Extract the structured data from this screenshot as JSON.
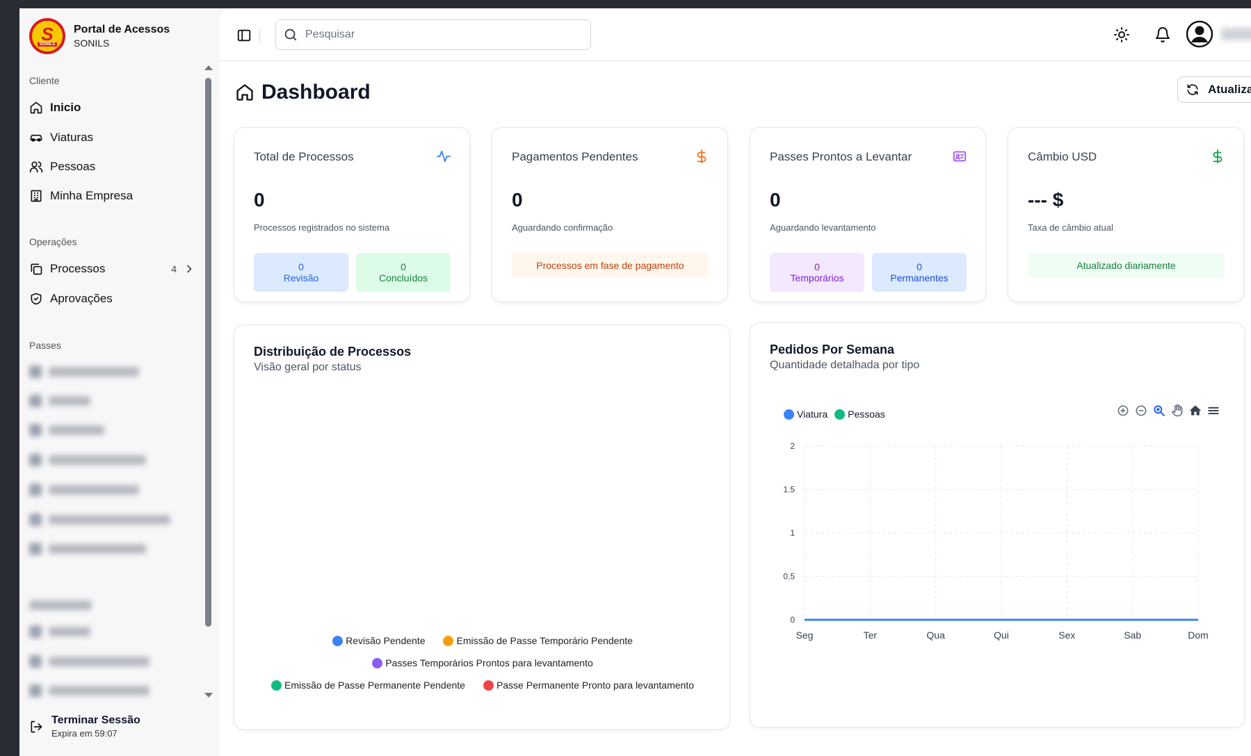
{
  "sidebar": {
    "brand_title": "Portal de Acessos",
    "brand_sub": "SONILS",
    "logo_text": "S",
    "logo_band": "SONILS",
    "section_cliente": "Cliente",
    "cliente_items": [
      {
        "label": "Inicio",
        "icon": "home-icon"
      },
      {
        "label": "Viaturas",
        "icon": "car-icon"
      },
      {
        "label": "Pessoas",
        "icon": "users-icon"
      },
      {
        "label": "Minha Empresa",
        "icon": "building-icon"
      }
    ],
    "section_operacoes": "Operações",
    "operacoes_items": [
      {
        "label": "Processos",
        "icon": "copy-icon",
        "count": "4"
      },
      {
        "label": "Aprovações",
        "icon": "shield-check-icon"
      }
    ],
    "section_passes": "Passes",
    "logout_title": "Terminar Sessão",
    "logout_sub": "Expira em 59:07"
  },
  "topbar": {
    "search_placeholder": "Pesquisar"
  },
  "page": {
    "title": "Dashboard",
    "refresh_label": "Atualizar"
  },
  "cards": [
    {
      "title": "Total de Processos",
      "icon": "activity-icon",
      "value": "0",
      "desc": "Processos registrados no sistema",
      "minis": [
        {
          "value": "0",
          "label": "Revisão",
          "color": "#2563eb",
          "bg": "#dbeafe"
        },
        {
          "value": "0",
          "label": "Concluídos",
          "color": "#15803d",
          "bg": "#dcfce7"
        }
      ]
    },
    {
      "title": "Pagamentos Pendentes",
      "icon": "dollar-icon",
      "value": "0",
      "desc": "Aguardando confirmação",
      "banner": "Processos em fase de pagamento"
    },
    {
      "title": "Passes Prontos a Levantar",
      "icon": "id-card-icon",
      "value": "0",
      "desc": "Aguardando levantamento",
      "minis": [
        {
          "value": "0",
          "label": "Temporários",
          "color": "#7e22ce",
          "bg": "#f3e8ff"
        },
        {
          "value": "0",
          "label": "Permanentes",
          "color": "#1d4ed8",
          "bg": "#dbeafe"
        }
      ]
    },
    {
      "title": "Câmbio USD",
      "icon": "dollar-icon",
      "value": "--- $",
      "desc": "Taxa de câmbio atual",
      "banner": "Atualizado diariamente"
    }
  ],
  "distribution": {
    "title": "Distribuição de Processos",
    "subtitle": "Visão geral por status",
    "legend": [
      {
        "label": "Revisão Pendente",
        "color": "#3b82f6"
      },
      {
        "label": "Emissão de Passe Temporário Pendente",
        "color": "#f59e0b"
      },
      {
        "label": "Passes Temporários Prontos para levantamento",
        "color": "#8b5cf6"
      },
      {
        "label": "Emissão de Passe Permanente Pendente",
        "color": "#10b981"
      },
      {
        "label": "Passe Permanente Pronto para levantamento",
        "color": "#ef4444"
      }
    ]
  },
  "weekly": {
    "title": "Pedidos Por Semana",
    "subtitle": "Quantidade detalhada por tipo"
  },
  "chart_data": {
    "type": "line",
    "categories": [
      "Seg",
      "Ter",
      "Qua",
      "Qui",
      "Sex",
      "Sab",
      "Dom"
    ],
    "series": [
      {
        "name": "Viatura",
        "values": [
          0,
          0,
          0,
          0,
          0,
          0,
          0
        ],
        "color": "#3b82f6"
      },
      {
        "name": "Pessoas",
        "values": [
          0,
          0,
          0,
          0,
          0,
          0,
          0
        ],
        "color": "#10b981"
      }
    ],
    "yticks": [
      "0",
      "0.5",
      "1",
      "1.5",
      "2"
    ],
    "ylim": [
      0,
      2
    ],
    "grid": true,
    "legend_position": "top-left"
  }
}
